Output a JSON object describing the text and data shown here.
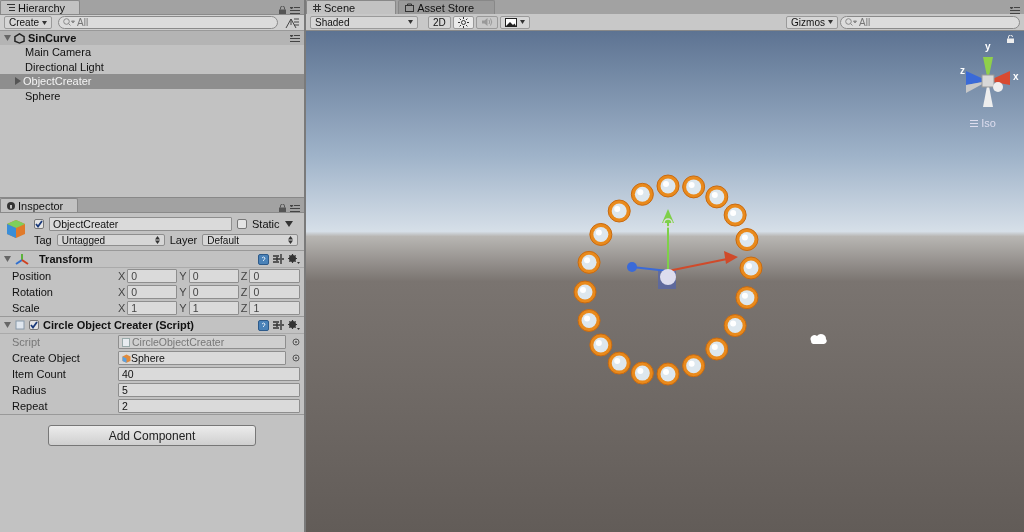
{
  "hierarchy": {
    "tab": "Hierarchy",
    "create": "Create",
    "search_placeholder": "All",
    "scene": "SinCurve",
    "items": [
      {
        "label": "Main Camera",
        "kind": "leaf",
        "selected": false
      },
      {
        "label": "Directional Light",
        "kind": "leaf",
        "selected": false
      },
      {
        "label": "ObjectCreater",
        "kind": "parent",
        "selected": true
      },
      {
        "label": "Sphere",
        "kind": "leaf",
        "selected": false
      }
    ]
  },
  "inspector": {
    "tab": "Inspector",
    "object_name": "ObjectCreater",
    "active": true,
    "static_label": "Static",
    "static": false,
    "tag_label": "Tag",
    "tag": "Untagged",
    "layer_label": "Layer",
    "layer": "Default",
    "transform": {
      "title": "Transform",
      "rows": [
        {
          "label": "Position",
          "values": [
            {
              "axis": "X",
              "value": "0"
            },
            {
              "axis": "Y",
              "value": "0"
            },
            {
              "axis": "Z",
              "value": "0"
            }
          ]
        },
        {
          "label": "Rotation",
          "values": [
            {
              "axis": "X",
              "value": "0"
            },
            {
              "axis": "Y",
              "value": "0"
            },
            {
              "axis": "Z",
              "value": "0"
            }
          ]
        },
        {
          "label": "Scale",
          "values": [
            {
              "axis": "X",
              "value": "1"
            },
            {
              "axis": "Y",
              "value": "1"
            },
            {
              "axis": "Z",
              "value": "1"
            }
          ]
        }
      ]
    },
    "script": {
      "title": "Circle Object Creater (Script)",
      "enabled": true,
      "fields": [
        {
          "label": "Script",
          "value": "CircleObjectCreater",
          "kind": "reference",
          "disabled": true
        },
        {
          "label": "Create Object",
          "value": "Sphere",
          "kind": "prefab",
          "disabled": false
        },
        {
          "label": "Item Count",
          "value": "40",
          "kind": "text",
          "disabled": false
        },
        {
          "label": "Radius",
          "value": "5",
          "kind": "text",
          "disabled": false
        },
        {
          "label": "Repeat",
          "value": "2",
          "kind": "text",
          "disabled": false
        }
      ]
    },
    "add_component": "Add Component"
  },
  "scene": {
    "tabs": [
      {
        "label": "Scene",
        "selected": true
      },
      {
        "label": "Asset Store",
        "selected": false
      }
    ],
    "shading": "Shaded",
    "mode_2d": "2D",
    "mode_2d_on": false,
    "lighting_on": true,
    "audio_on": false,
    "gizmos": "Gizmos",
    "search_placeholder": "All",
    "axis_labels": {
      "y": "y",
      "z": "z",
      "x": "x"
    },
    "projection": "Iso"
  }
}
